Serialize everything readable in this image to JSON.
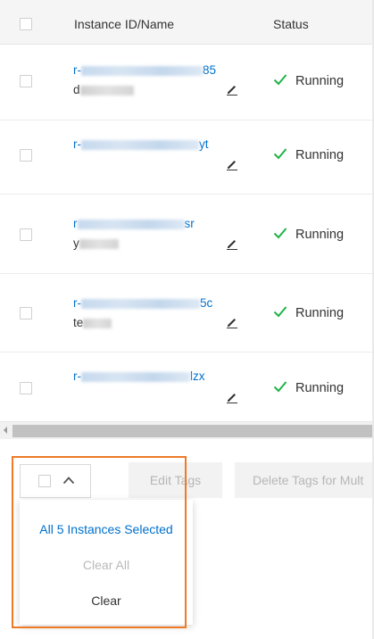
{
  "table": {
    "columns": [
      "Instance ID/Name",
      "Status"
    ],
    "rows": [
      {
        "id_prefix": "r-",
        "id_suffix": "85",
        "name_prefix": "d",
        "name_suffix": "",
        "status": "Running"
      },
      {
        "id_prefix": "r-",
        "id_suffix": "yt",
        "name_prefix": "",
        "name_suffix": "",
        "status": "Running"
      },
      {
        "id_prefix": "r",
        "id_suffix": "sr",
        "name_prefix": "y",
        "name_suffix": "",
        "status": "Running"
      },
      {
        "id_prefix": "r-",
        "id_suffix": "5c",
        "name_prefix": "te",
        "name_suffix": "",
        "status": "Running"
      },
      {
        "id_prefix": "r-",
        "id_suffix": "lzx",
        "name_prefix": "",
        "name_suffix": "",
        "status": "Running"
      }
    ]
  },
  "bulk_actions": {
    "edit_tags": "Edit Tags",
    "delete_tags": "Delete Tags for Mult"
  },
  "dropdown": {
    "all_selected": "All 5 Instances Selected",
    "clear_all": "Clear All",
    "clear": "Clear"
  },
  "icons": {
    "status_check": "check-icon",
    "edit": "pencil-icon",
    "toggle": "chevron-up-icon"
  },
  "colors": {
    "link": "#0070cc",
    "success": "#1fb347",
    "highlight": "#ee7a26",
    "disabled_text": "#b6b6b6"
  }
}
